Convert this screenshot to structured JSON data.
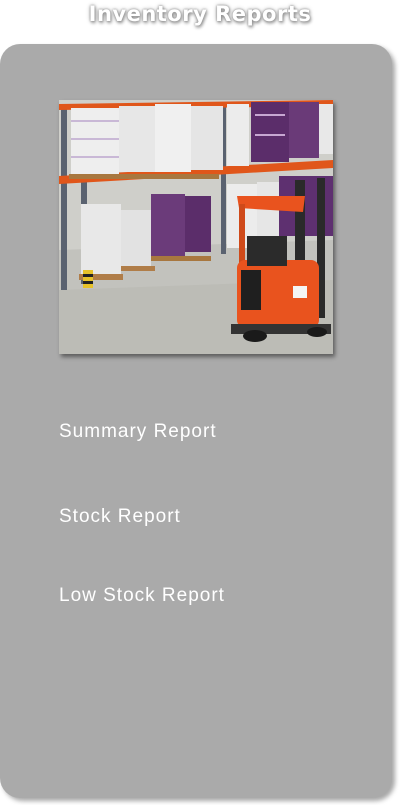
{
  "header": {
    "title": "Inventory Reports"
  },
  "hero": {
    "icon": "warehouse-forklift-photo"
  },
  "menu": {
    "items": [
      {
        "label": "Summary Report"
      },
      {
        "label": "Stock Report"
      },
      {
        "label": "Low Stock Report"
      }
    ]
  },
  "colors": {
    "panel": "#aaaaaa",
    "text": "#ffffff",
    "rack_orange": "#e0561a",
    "forklift_orange": "#e9531e"
  }
}
